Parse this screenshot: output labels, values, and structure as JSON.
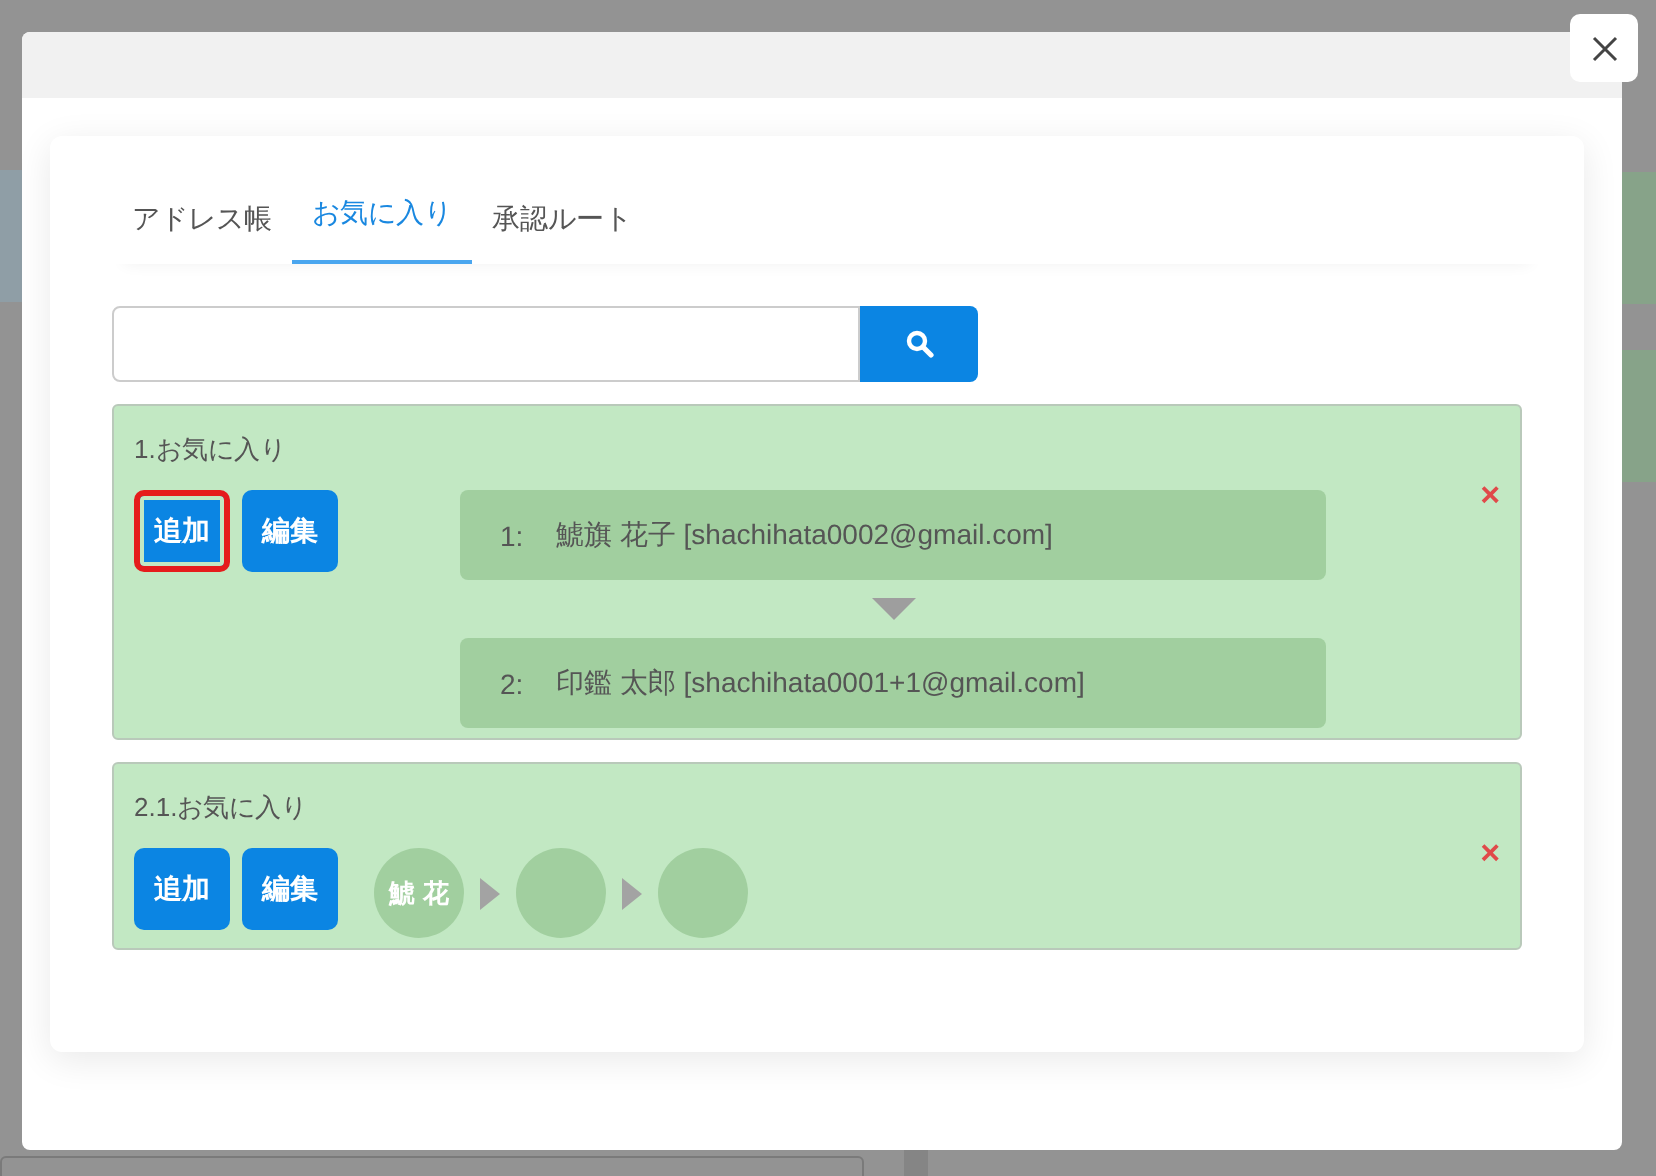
{
  "tabs": [
    {
      "label": "アドレス帳",
      "selected": false
    },
    {
      "label": "お気に入り",
      "selected": true
    },
    {
      "label": "承認ルート",
      "selected": false
    }
  ],
  "groups": [
    {
      "title": "1.お気に入り",
      "kind": "list",
      "buttons": [
        {
          "label": "追加",
          "highlighted": true
        },
        {
          "label": "編集",
          "highlighted": false
        }
      ],
      "members": [
        {
          "number": "1:",
          "text": "鯱旗 花子 [shachihata0002@gmail.com]"
        },
        {
          "number": "2:",
          "text": "印鑑 太郎 [shachihata0001+1@gmail.com]"
        }
      ],
      "remove": "×"
    },
    {
      "title": "2.1.お気に入り",
      "kind": "circles",
      "buttons": [
        {
          "label": "追加",
          "highlighted": false
        },
        {
          "label": "編集",
          "highlighted": false
        }
      ],
      "members": [
        {
          "kind": "initials",
          "text": "鯱 花"
        },
        {
          "kind": "blank"
        },
        {
          "kind": "blank"
        }
      ],
      "remove": "×"
    }
  ]
}
